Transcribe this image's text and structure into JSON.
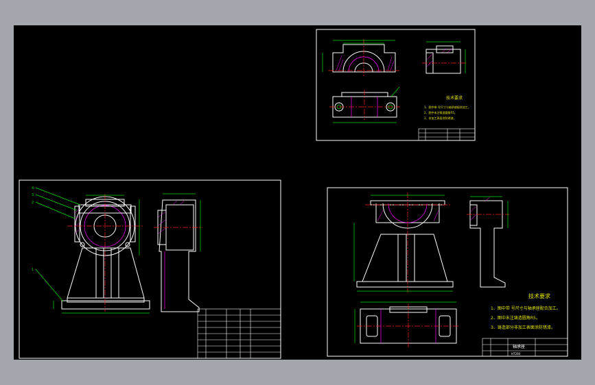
{
  "colors": {
    "background": "#a3a6ad",
    "canvas": "#000000",
    "outline": "#ffffff",
    "dimension": "#00e000",
    "hatch": "#ff00ff",
    "centerline": "#ff2020",
    "note_text": "#e6e600"
  },
  "sheets": {
    "top_right": {
      "tech_title": "技术要求",
      "tech_notes": [
        "1、图中带     号尺寸与轴承座配合加工。",
        "2、图中未注铸造圆角R5。",
        "3、非加工表面涂防锈漆。"
      ]
    },
    "left": {
      "callouts": [
        "1",
        "2",
        "3",
        "4"
      ]
    },
    "bottom_right": {
      "tech_title": "技术要求",
      "tech_notes": [
        "1、图中带     号尺寸与轴承座配合加工。",
        "2、图中未注铸造圆角R5。",
        "3、铸造部分非加工表面涂防锈漆。"
      ],
      "part_name": "轴承座",
      "material": "HT200"
    }
  }
}
